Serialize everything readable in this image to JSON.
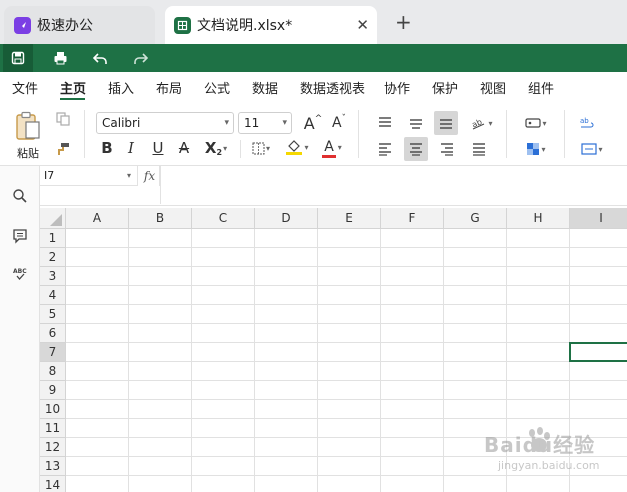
{
  "tabs": {
    "app_tab_label": "极速办公",
    "doc_tab_label": "文档说明.xlsx*",
    "close_glyph": "✕",
    "new_tab_glyph": "+"
  },
  "quick_toolbar": {
    "icons": [
      "save-icon",
      "print-icon",
      "undo-icon",
      "redo-icon"
    ]
  },
  "menu": {
    "items": [
      "文件",
      "主页",
      "插入",
      "布局",
      "公式",
      "数据",
      "数据透视表",
      "协作",
      "保护",
      "视图",
      "组件"
    ],
    "active": "主页"
  },
  "ribbon": {
    "paste_label": "粘贴",
    "font_name": "Calibri",
    "font_size": "11",
    "bold": "B",
    "italic": "I",
    "underline": "U",
    "strike": "A",
    "subscript": "X",
    "subscript_sub": "2",
    "increase_font": "A",
    "decrease_font": "A",
    "font_color_letter": "A",
    "font_color": "#e03030",
    "fill_color": "#f5d800"
  },
  "formula_bar": {
    "cell_ref": "I7",
    "fx_label": "fx",
    "formula": ""
  },
  "sheet": {
    "columns": [
      "A",
      "B",
      "C",
      "D",
      "E",
      "F",
      "G",
      "H",
      "I"
    ],
    "rows": [
      "1",
      "2",
      "3",
      "4",
      "5",
      "6",
      "7",
      "8",
      "9",
      "10",
      "11",
      "12",
      "13",
      "14"
    ],
    "active_cell": "I7",
    "selected_column": "I",
    "selected_row": "7",
    "accent": "#1e7145"
  },
  "watermark": {
    "text": "Baidu经验",
    "sub": "jingyan.baidu.com"
  }
}
